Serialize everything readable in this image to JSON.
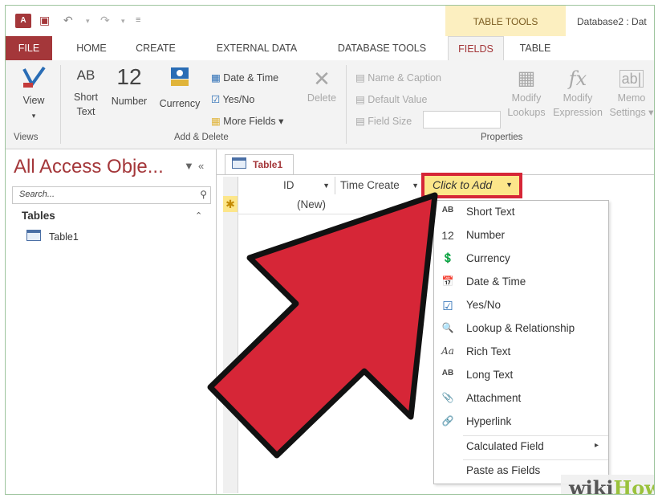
{
  "titlebar": {
    "app_icon": "A",
    "table_tools": "TABLE TOOLS",
    "db_title": "Database2 : Dat"
  },
  "ribbon_tabs": [
    "FILE",
    "HOME",
    "CREATE",
    "EXTERNAL DATA",
    "DATABASE TOOLS",
    "FIELDS",
    "TABLE"
  ],
  "ribbon": {
    "view": {
      "label": "View",
      "arrow": "▾"
    },
    "views_group": "Views",
    "short_text": {
      "glyph": "AB",
      "line1": "Short",
      "line2": "Text"
    },
    "number": {
      "glyph": "12",
      "label": "Number"
    },
    "currency": {
      "label": "Currency"
    },
    "date_time": "Date & Time",
    "yes_no": "Yes/No",
    "more_fields": "More Fields ▾",
    "delete": "Delete",
    "add_delete_group": "Add & Delete",
    "name_caption": "Name & Caption",
    "default_value": "Default Value",
    "field_size": "Field Size",
    "modify_lookups": {
      "line1": "Modify",
      "line2": "Lookups"
    },
    "modify_expression": {
      "line1": "Modify",
      "line2": "Expression"
    },
    "memo_settings": {
      "line1": "Memo",
      "line2": "Settings ▾"
    },
    "properties_group": "Properties"
  },
  "nav": {
    "title": "All Access Obje...",
    "search_placeholder": "Search...",
    "group": "Tables",
    "items": [
      "Table1"
    ]
  },
  "doc": {
    "tab": "Table1",
    "columns": [
      "ID",
      "Time Create",
      "Click to Add"
    ],
    "new_row_marker": "✱",
    "new_row_value": "(New)"
  },
  "menu": [
    {
      "icon": "AB",
      "label": "Short Text"
    },
    {
      "icon": "12",
      "label": "Number"
    },
    {
      "icon": "💲",
      "label": "Currency"
    },
    {
      "icon": "📅",
      "label": "Date & Time"
    },
    {
      "icon": "☑",
      "label": "Yes/No"
    },
    {
      "icon": "🔍",
      "label": "Lookup & Relationship"
    },
    {
      "icon": "Aa",
      "label": "Rich Text"
    },
    {
      "icon": "AB",
      "label": "Long Text"
    },
    {
      "icon": "📎",
      "label": "Attachment"
    },
    {
      "icon": "🔗",
      "label": "Hyperlink"
    },
    {
      "icon": "",
      "label": "Calculated Field",
      "submenu": "▸"
    },
    {
      "icon": "",
      "label": "Paste as Fields"
    }
  ],
  "watermark": {
    "part1": "wiki",
    "part2": "How"
  },
  "colors": {
    "access_red": "#a4373a",
    "highlight_yellow": "#fce68a",
    "arrow_red": "#d62637"
  }
}
